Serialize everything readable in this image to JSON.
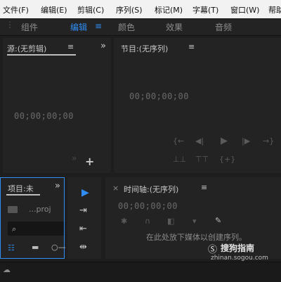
{
  "menu": {
    "items": [
      "文件(F)",
      "编辑(E)",
      "剪辑(C)",
      "序列(S)",
      "标记(M)",
      "字幕(T)",
      "窗口(W)",
      "帮助"
    ]
  },
  "workspace": {
    "tabs": [
      "组件",
      "编辑",
      "颜色",
      "效果",
      "音频"
    ],
    "active": "编辑",
    "menu_icon": "≡"
  },
  "source_panel": {
    "title": "源:(无剪辑)",
    "menu_icon": "≡",
    "expand_icon": "»",
    "timecode": "00;00;00;00",
    "add_glyph": "+",
    "more_glyph": "»"
  },
  "program_panel": {
    "title": "节目:(无序列)",
    "menu_icon": "≡",
    "timecode": "00;00;00;00",
    "transport": [
      "{←",
      "◀|",
      "▶",
      "|▶",
      "→}"
    ],
    "transport2": [
      "⊥⊥",
      "⊤⊤",
      "{+}"
    ]
  },
  "project_panel": {
    "title": "项目:未",
    "expand_icon": "»",
    "file_label": "...proj"
  },
  "tools": [
    "▶",
    "⇥",
    "⇤",
    "⇹"
  ],
  "timeline_panel": {
    "close_icon": "×",
    "title": "时间轴:(无序列)",
    "menu_icon": "≡",
    "timecode": "00;00;00;00",
    "hint": "在此处放下媒体以创建序列。"
  },
  "watermark": {
    "brand": "搜狗指南",
    "url": "zhinan.sogou.com"
  },
  "colors": {
    "accent": "#2f8df5",
    "panel_bg": "#232323",
    "app_bg": "#1e1e1e"
  }
}
